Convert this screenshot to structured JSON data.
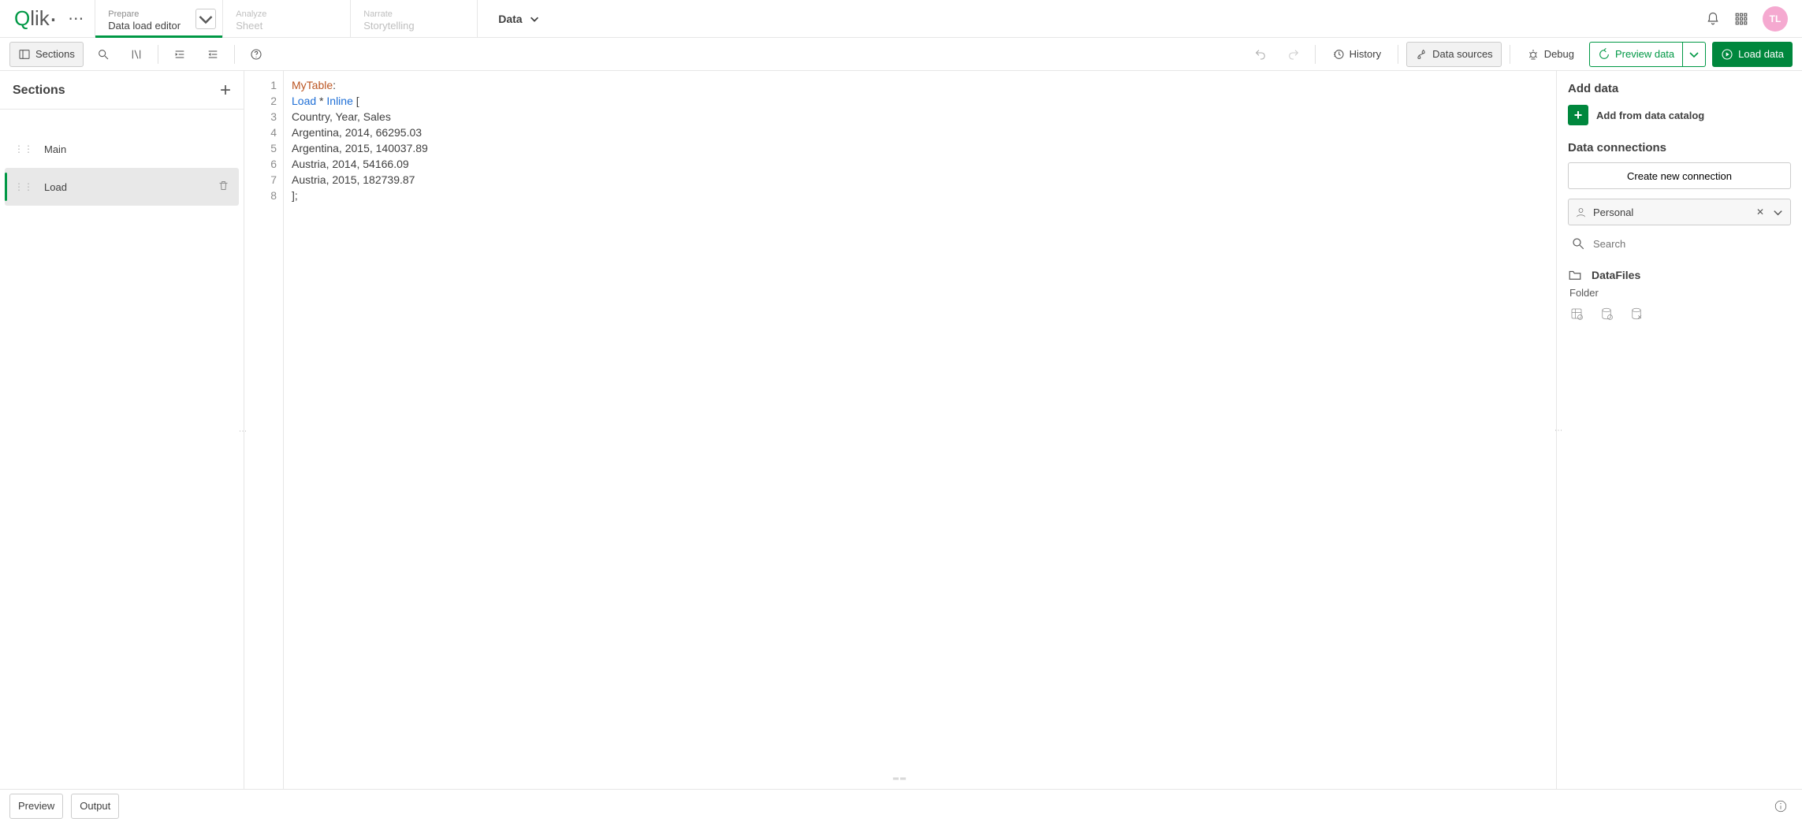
{
  "header": {
    "tabs": [
      {
        "small": "Prepare",
        "big": "Data load editor"
      },
      {
        "small": "Analyze",
        "big": "Sheet"
      },
      {
        "small": "Narrate",
        "big": "Storytelling"
      }
    ],
    "center_label": "Data",
    "avatar": "TL"
  },
  "toolbar": {
    "sections": "Sections",
    "history": "History",
    "data_sources": "Data sources",
    "debug": "Debug",
    "preview_data": "Preview data",
    "load_data": "Load data"
  },
  "sections_panel": {
    "title": "Sections",
    "items": [
      {
        "label": "Main"
      },
      {
        "label": "Load"
      }
    ]
  },
  "editor": {
    "line_numbers": [
      "1",
      "2",
      "3",
      "4",
      "5",
      "6",
      "7",
      "8"
    ],
    "lines": {
      "l1_table": "MyTable",
      "l2_load": "Load",
      "l2_star": " * ",
      "l2_inline": "Inline",
      "l2_rest": " [",
      "l3": "Country, Year, Sales",
      "l4": "Argentina, 2014, 66295.03",
      "l5": "Argentina, 2015, 140037.89",
      "l6": "Austria, 2014, 54166.09",
      "l7": "Austria, 2015, 182739.87",
      "l8": "];"
    }
  },
  "right_panel": {
    "add_data": "Add data",
    "add_catalog": "Add from data catalog",
    "connections_title": "Data connections",
    "create_conn": "Create new connection",
    "space": "Personal",
    "search_placeholder": "Search",
    "conn_name": "DataFiles",
    "conn_type": "Folder"
  },
  "footer": {
    "preview": "Preview",
    "output": "Output"
  }
}
